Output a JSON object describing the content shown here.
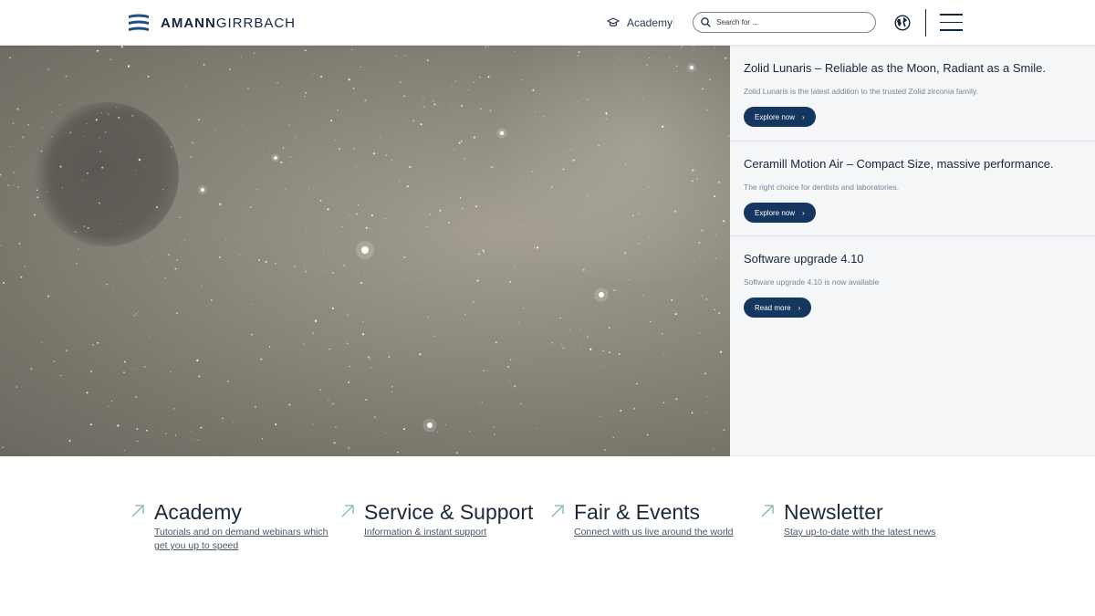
{
  "header": {
    "logo_bold": "AMANN",
    "logo_light": "GIRRBACH",
    "academy_label": "Academy",
    "search_placeholder": "Search for ...",
    "icons": [
      "academy-cap-icon",
      "search-icon",
      "globe-icon",
      "menu-icon"
    ]
  },
  "panel": {
    "cards": [
      {
        "title": "Zolid Lunaris – Reliable as the Moon, Radiant as a Smile.",
        "text": "Zolid Lunaris is the latest addition to the trusted Zolid zirconia family.",
        "button": "Explore now"
      },
      {
        "title": "Ceramill Motion Air – Compact Size, massive performance.",
        "text": "The right choice for dentists and laboratories.",
        "button": "Explore now"
      },
      {
        "title": "Software upgrade 4.10",
        "text": "Software upgrade 4.10 is now available",
        "button": "Read more"
      }
    ]
  },
  "quicklinks": [
    {
      "title": "Academy",
      "sub1": "Tutorials and on demand webinars which",
      "sub2": "get you up to speed"
    },
    {
      "title": "Service & Support",
      "sub1": "Information & instant support",
      "sub2": ""
    },
    {
      "title": "Fair & Events",
      "sub1": "Connect with us live around the world",
      "sub2": ""
    },
    {
      "title": "Newsletter",
      "sub1": "Stay up-to-date with the latest news",
      "sub2": ""
    }
  ],
  "colors": {
    "brand_navy": "#14365f",
    "arrow_teal": "#7fb8b2",
    "panel_bg": "#f5f6f8"
  }
}
